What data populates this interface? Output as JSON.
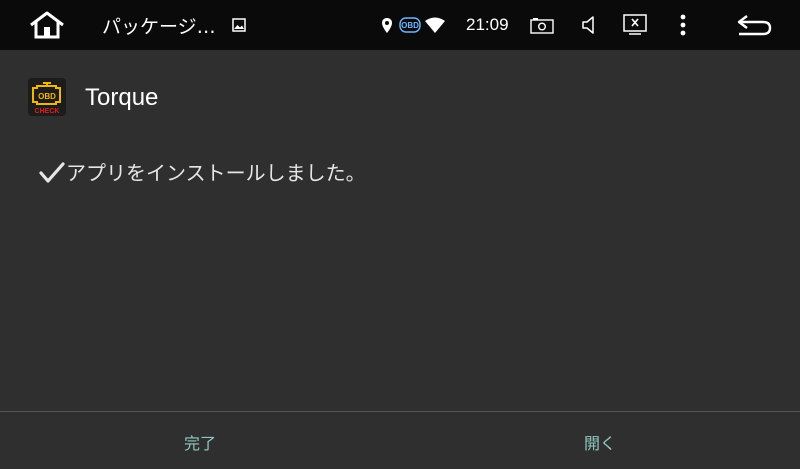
{
  "status_bar": {
    "title": "パッケージ…",
    "time": "21:09",
    "icons": {
      "home": "home-icon",
      "image": "image-icon",
      "location": "location-icon",
      "obd": "obd-icon",
      "wifi": "wifi-icon",
      "camera": "camera-icon",
      "volume": "volume-icon",
      "screen_close": "screen-close-icon",
      "menu": "more-vertical-icon",
      "back": "back-icon"
    },
    "obd_label": "OBD"
  },
  "app": {
    "name": "Torque",
    "icon_text_top": "OBD",
    "icon_text_bottom": "CHECK"
  },
  "message": "アプリをインストールしました。",
  "actions": {
    "done_label": "完了",
    "open_label": "開く"
  },
  "colors": {
    "status_bar_bg": "#0a0a0a",
    "content_bg": "#2f2f2f",
    "action_text": "#8fc9c1"
  }
}
